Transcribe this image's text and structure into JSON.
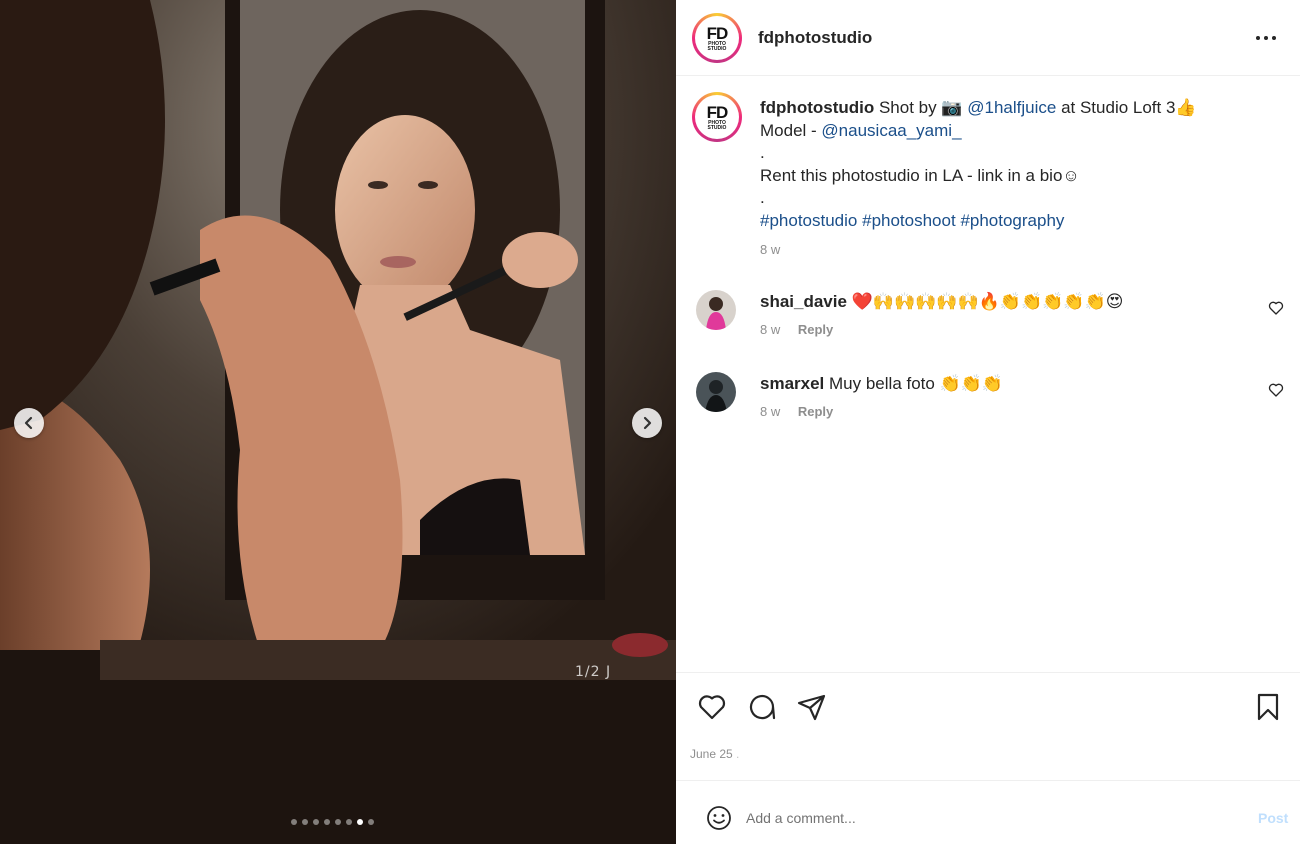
{
  "post": {
    "username": "fdphotostudio",
    "logo": {
      "big": "FD",
      "small_1": "PHOTO",
      "small_2": "STUDIO"
    },
    "media": {
      "counter": "1/2 J",
      "dots_total": 8,
      "active_dot": 7
    },
    "caption": {
      "username": "fdphotostudio",
      "text_1": " Shot by 📷 ",
      "mention_photographer": "@1halfjuice",
      "text_2": " at Studio Loft 3👍",
      "line_2_prefix": "Model - ",
      "mention_model": "@nausicaa_yami_",
      "dot_1": ".",
      "line_4": "Rent this photostudio in LA - link in a bio☺",
      "dot_2": ".",
      "hashtags": [
        "#photostudio",
        "#photoshoot",
        "#photography"
      ],
      "time": "8 w"
    },
    "comments": [
      {
        "username": "shai_davie",
        "text": "❤️🙌🙌🙌🙌🙌🔥👏👏👏👏👏😍",
        "time": "8 w",
        "reply_label": "Reply"
      },
      {
        "username": "smarxel",
        "text": "Muy bella foto 👏👏👏",
        "time": "8 w",
        "reply_label": "Reply"
      }
    ],
    "date": {
      "main": "June 25",
      "dim": "."
    },
    "comment_box": {
      "placeholder": "Add a comment...",
      "post_label": "Post"
    }
  },
  "icons": {
    "more": "more-options-icon",
    "like": "heart-icon",
    "comment": "comment-icon",
    "share": "send-icon",
    "save": "bookmark-icon",
    "emoji": "emoji-icon",
    "prev": "chevron-left-icon",
    "next": "chevron-right-icon"
  },
  "colors": {
    "link": "#1b4f8a",
    "muted": "#8e8e8e",
    "post_button": "#c0dffd"
  }
}
